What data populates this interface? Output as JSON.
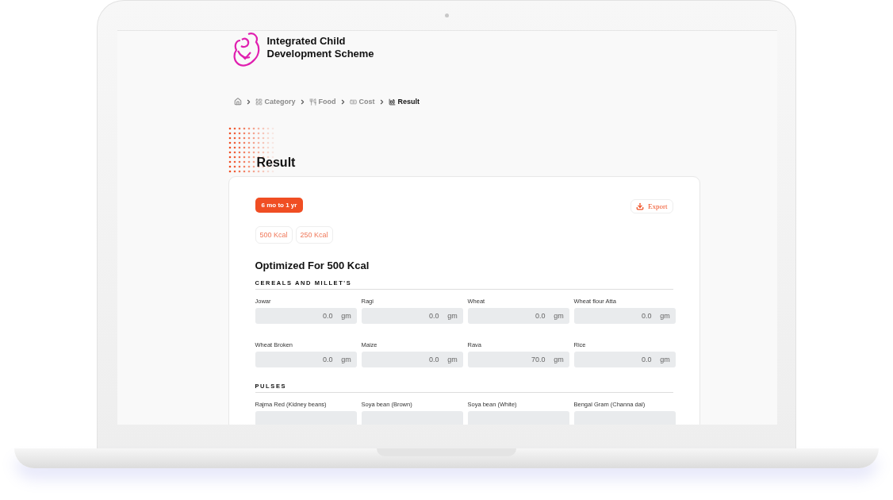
{
  "brand": {
    "title_lines": [
      "Integrated Child",
      "Development Scheme"
    ]
  },
  "breadcrumb": [
    {
      "kind": "home",
      "selected": false
    },
    {
      "kind": "category",
      "label": "Category",
      "selected": false
    },
    {
      "kind": "food",
      "label": "Food",
      "selected": false
    },
    {
      "kind": "cost",
      "label": "Cost",
      "selected": false
    },
    {
      "kind": "result",
      "label": "Result",
      "selected": true
    }
  ],
  "page_title": "Result",
  "age_badge": "6 mo to 1 yr",
  "export_button": "Export",
  "kcal_chips": [
    "500 Kcal",
    "250 Kcal"
  ],
  "heading": "Optimized For 500 Kcal",
  "sections": [
    {
      "title": "CEREALS AND MILLET'S",
      "items": [
        {
          "label": "Jowar",
          "value": "0.0",
          "unit": "gm"
        },
        {
          "label": "Ragi",
          "value": "0.0",
          "unit": "gm"
        },
        {
          "label": "Wheat",
          "value": "0.0",
          "unit": "gm"
        },
        {
          "label": "Wheat flour Atta",
          "value": "0.0",
          "unit": "gm"
        },
        {
          "label": "Wheat Broken",
          "value": "0.0",
          "unit": "gm"
        },
        {
          "label": "Maize",
          "value": "0.0",
          "unit": "gm"
        },
        {
          "label": "Rava",
          "value": "70.0",
          "unit": "gm"
        },
        {
          "label": "Rice",
          "value": "0.0",
          "unit": "gm"
        }
      ]
    },
    {
      "title": "PULSES",
      "items": [
        {
          "label": "Rajma Red (Kidney beans)"
        },
        {
          "label": "Soya bean (Brown)"
        },
        {
          "label": "Soya bean (White)"
        },
        {
          "label": "Bengal Gram (Channa dal)"
        }
      ]
    }
  ]
}
